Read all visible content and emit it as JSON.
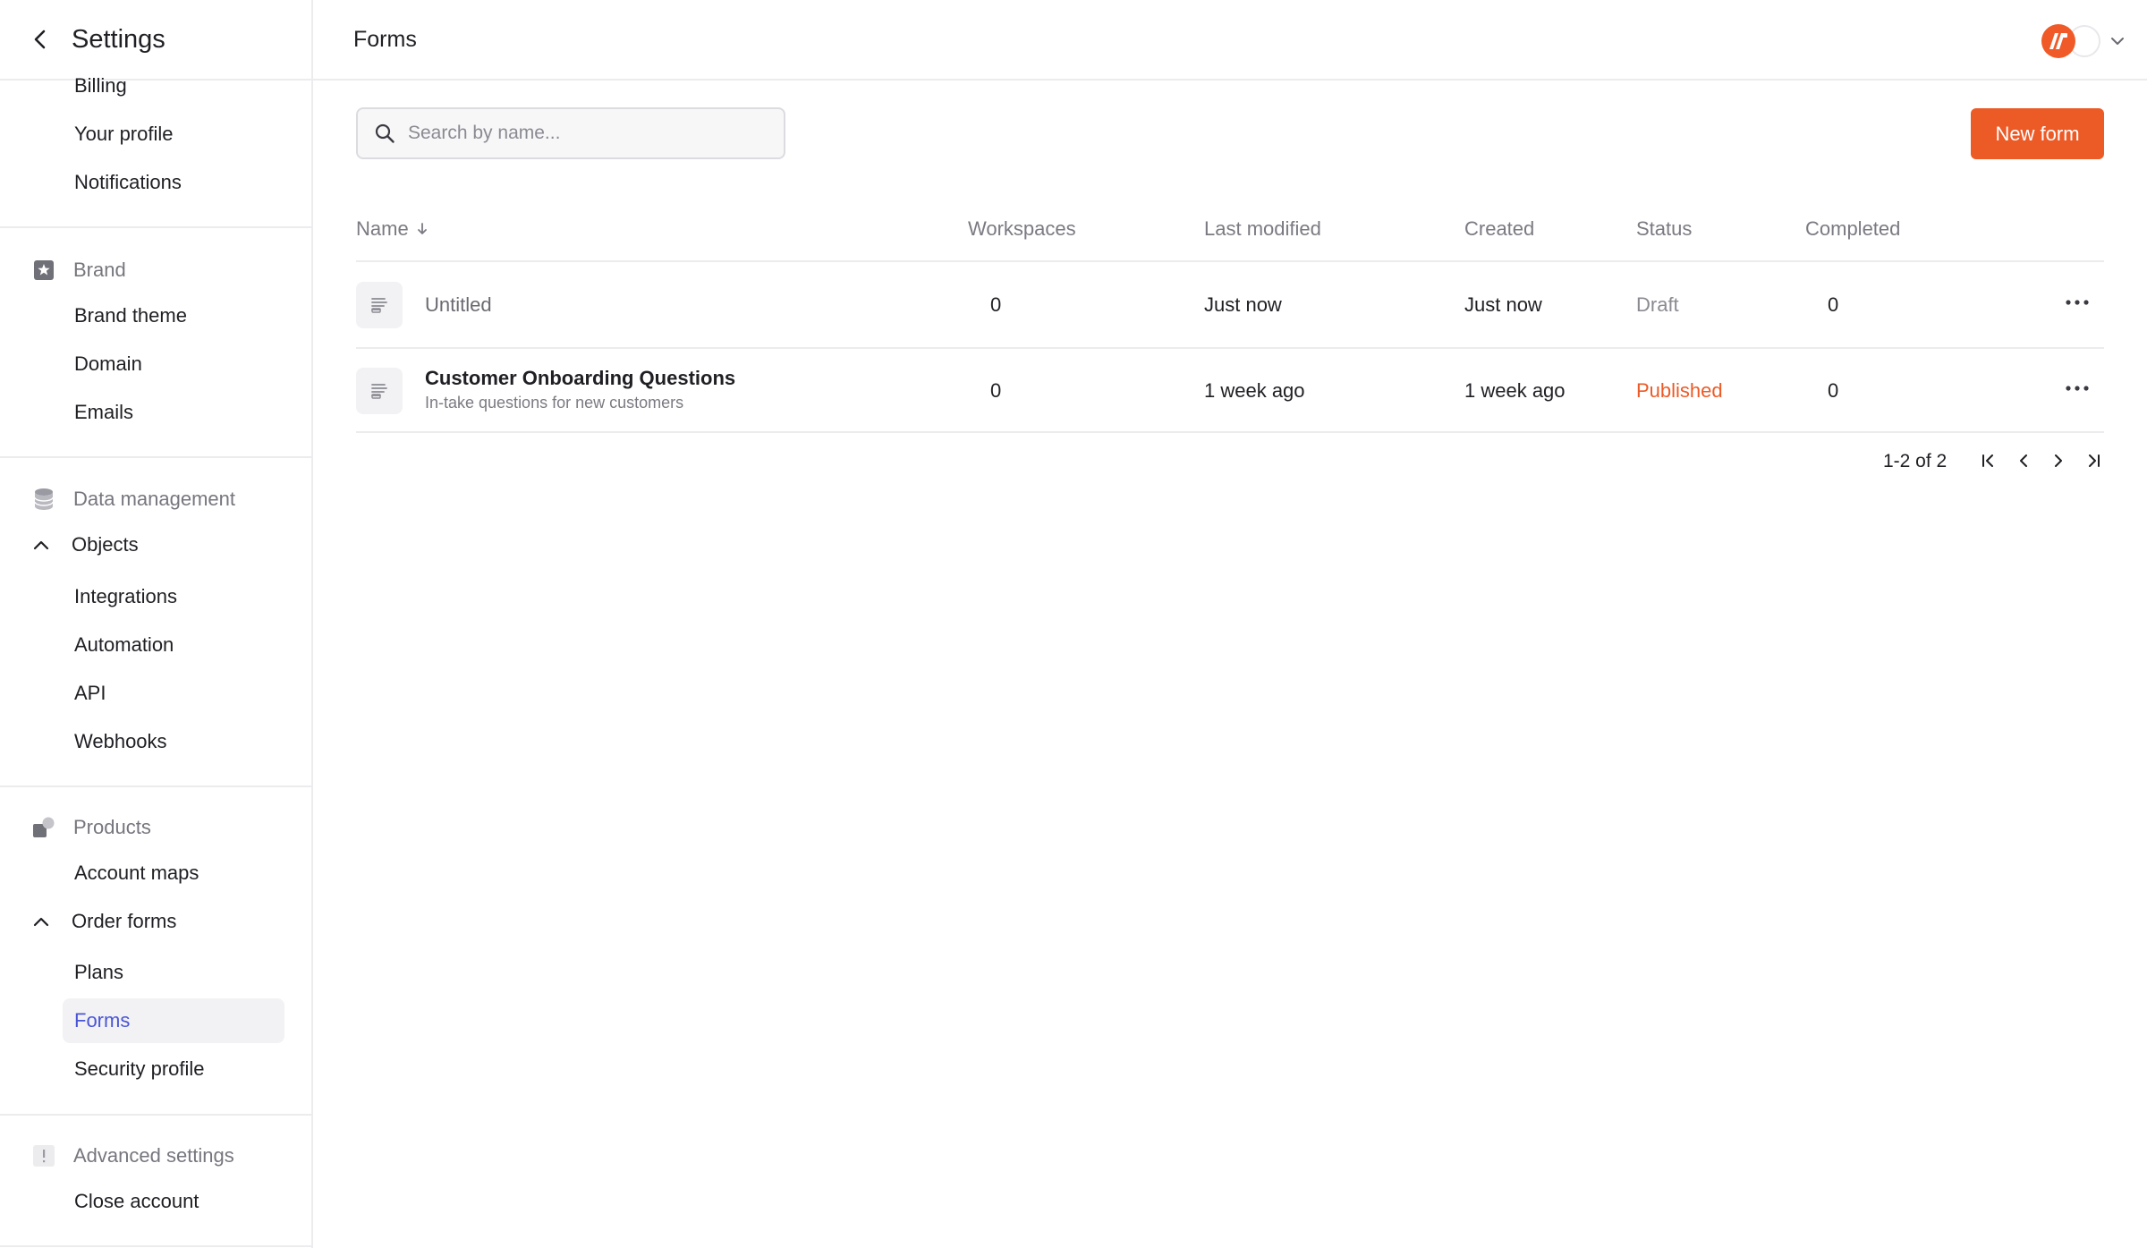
{
  "sidebar": {
    "title": "Settings",
    "items_top": [
      {
        "label": "Billing"
      },
      {
        "label": "Your profile"
      },
      {
        "label": "Notifications"
      }
    ],
    "brand": {
      "section": "Brand",
      "items": [
        {
          "label": "Brand theme"
        },
        {
          "label": "Domain"
        },
        {
          "label": "Emails"
        }
      ]
    },
    "data_management": {
      "section": "Data management",
      "expand_label": "Objects",
      "items": [
        {
          "label": "Integrations"
        },
        {
          "label": "Automation"
        },
        {
          "label": "API"
        },
        {
          "label": "Webhooks"
        }
      ]
    },
    "products": {
      "section": "Products",
      "items_before": [
        {
          "label": "Account maps"
        }
      ],
      "expand_label": "Order forms",
      "items": [
        {
          "label": "Plans"
        },
        {
          "label": "Forms"
        },
        {
          "label": "Security profile"
        }
      ]
    },
    "advanced": {
      "section": "Advanced settings",
      "items": [
        {
          "label": "Close account"
        }
      ]
    }
  },
  "header": {
    "title": "Forms"
  },
  "toolbar": {
    "search_placeholder": "Search by name...",
    "new_button": "New form"
  },
  "table": {
    "columns": [
      "Name",
      "Workspaces",
      "Last modified",
      "Created",
      "Status",
      "Completed"
    ],
    "rows": [
      {
        "name": "Untitled",
        "description": "",
        "workspaces": "0",
        "last_modified": "Just now",
        "created": "Just now",
        "status": "Draft",
        "completed": "0"
      },
      {
        "name": "Customer Onboarding Questions",
        "description": "In-take questions for new customers",
        "workspaces": "0",
        "last_modified": "1 week ago",
        "created": "1 week ago",
        "status": "Published",
        "completed": "0"
      }
    ]
  },
  "pagination": {
    "label": "1-2 of 2"
  },
  "colors": {
    "accent": "#ec5a26",
    "active_nav": "#4a55d6",
    "draft": "#8a8a92",
    "published": "#ec5a26"
  }
}
